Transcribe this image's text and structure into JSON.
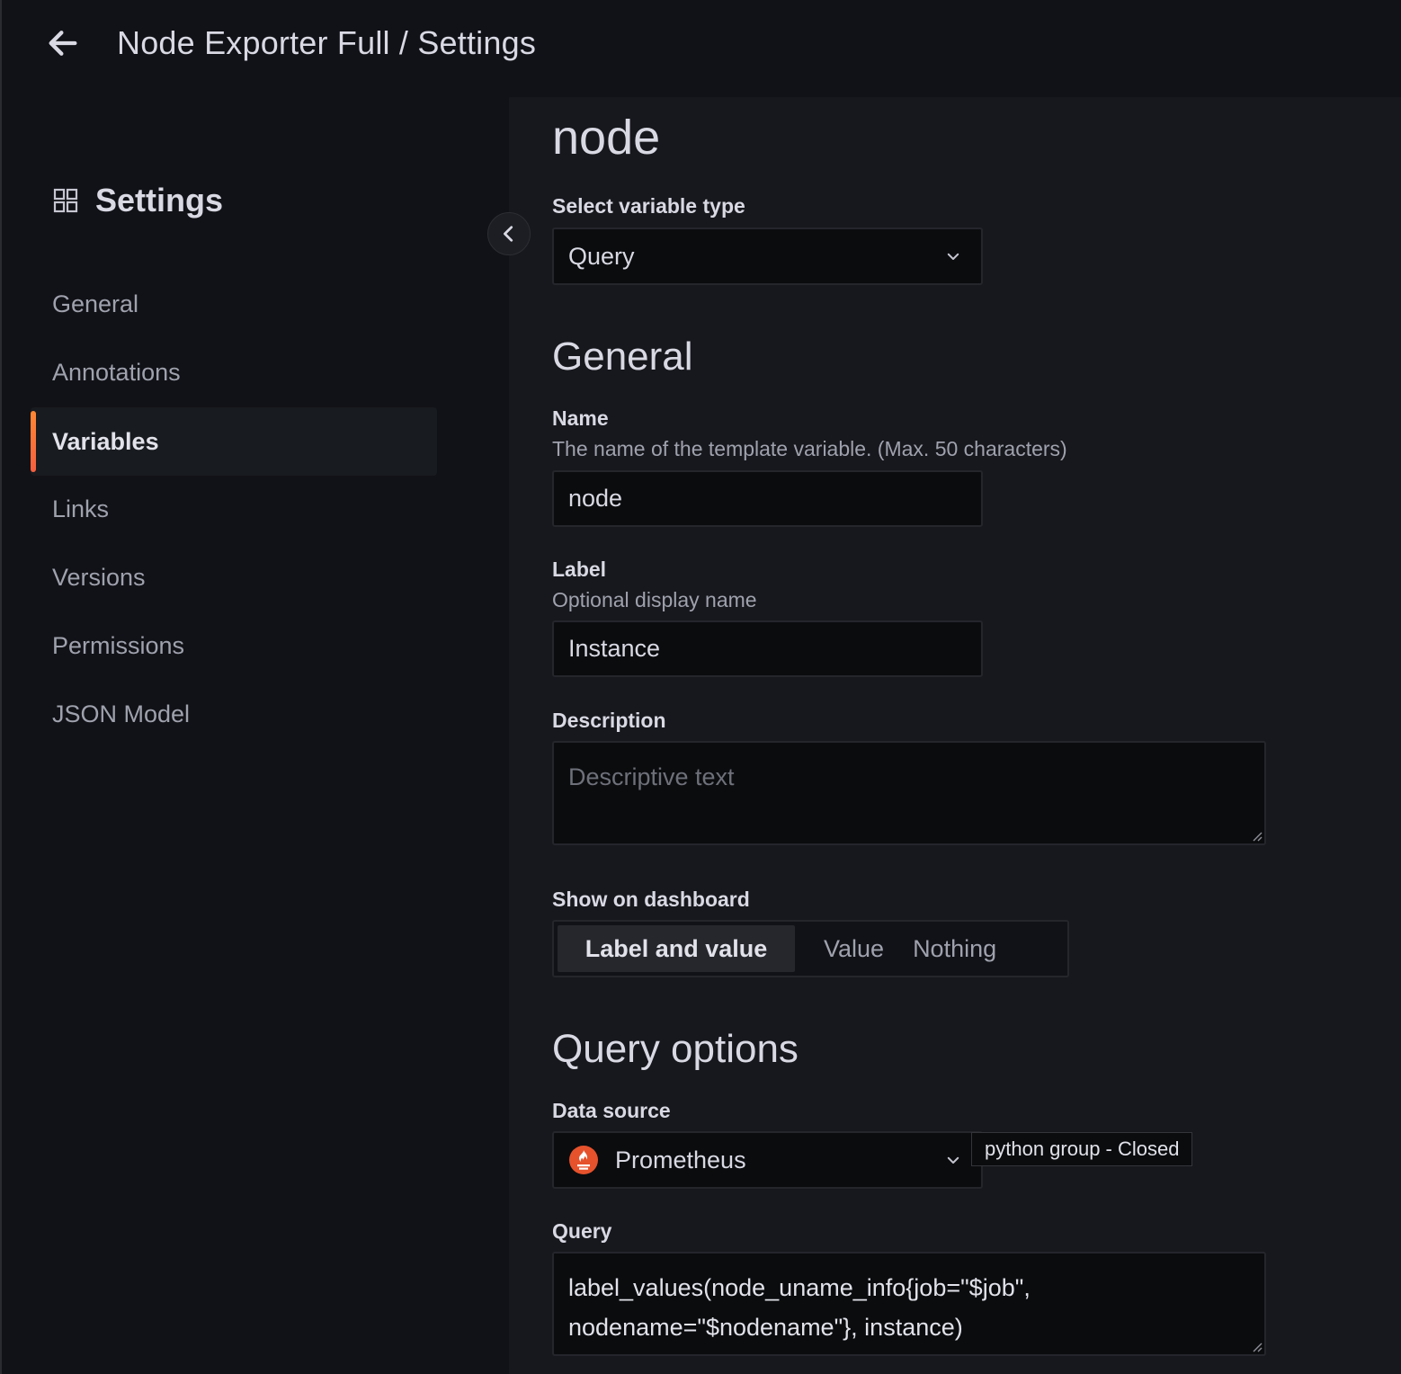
{
  "header": {
    "title": "Node Exporter Full / Settings",
    "back_icon": "arrow-left-icon"
  },
  "sidebar": {
    "heading": "Settings",
    "items": [
      {
        "label": "General",
        "active": false
      },
      {
        "label": "Annotations",
        "active": false
      },
      {
        "label": "Variables",
        "active": true
      },
      {
        "label": "Links",
        "active": false
      },
      {
        "label": "Versions",
        "active": false
      },
      {
        "label": "Permissions",
        "active": false
      },
      {
        "label": "JSON Model",
        "active": false
      }
    ]
  },
  "main": {
    "variable_title": "node",
    "variable_type": {
      "label": "Select variable type",
      "value": "Query"
    },
    "general": {
      "title": "General",
      "name": {
        "label": "Name",
        "description": "The name of the template variable. (Max. 50 characters)",
        "value": "node"
      },
      "label": {
        "label": "Label",
        "description": "Optional display name",
        "value": "Instance"
      },
      "description": {
        "label": "Description",
        "placeholder": "Descriptive text"
      },
      "show_on_dashboard": {
        "label": "Show on dashboard",
        "options": [
          "Label and value",
          "Value",
          "Nothing"
        ],
        "selected": "Label and value"
      }
    },
    "query_options": {
      "title": "Query options",
      "data_source": {
        "label": "Data source",
        "value": "Prometheus",
        "tooltip": "python group - Closed"
      },
      "query": {
        "label": "Query",
        "line1": "label_values(node_uname_info{job=\"$job\",",
        "line2": "nodename=\"$nodename\"}, instance)"
      }
    }
  },
  "colors": {
    "accent_start": "#ff8833",
    "accent_end": "#f55f3e",
    "prometheus": "#e6522c"
  }
}
